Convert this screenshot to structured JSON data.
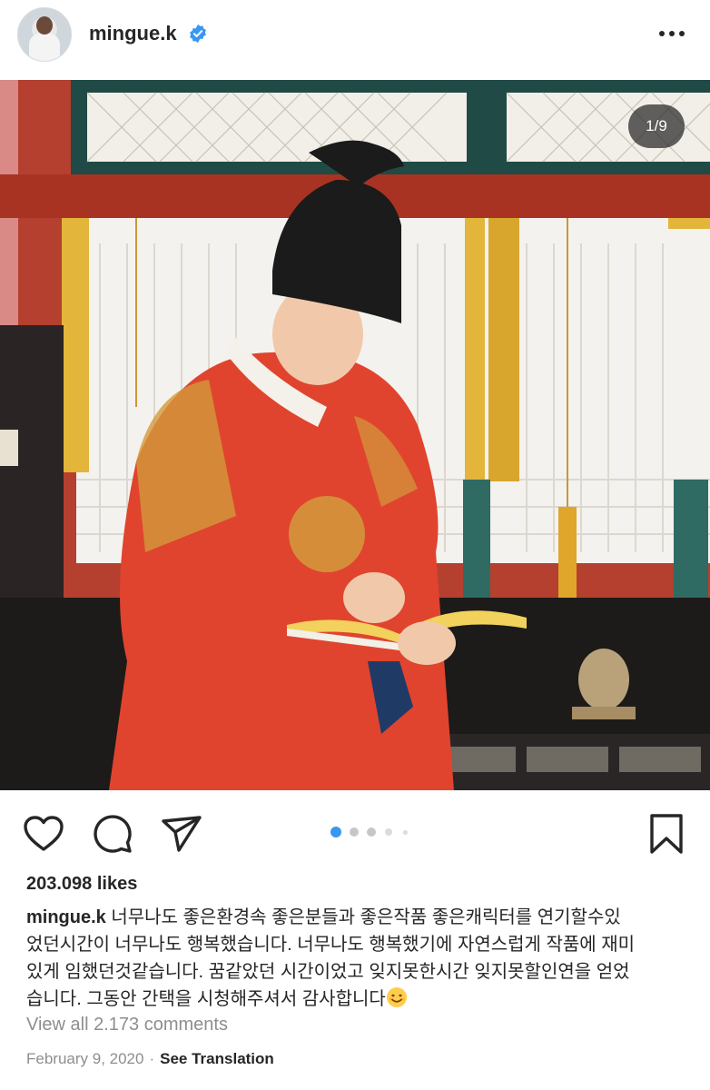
{
  "post": {
    "username": "mingue.k",
    "verified": true,
    "more_icon": "more-horizontal-icon"
  },
  "media": {
    "counter": "1/9",
    "current_index": 1,
    "total": 9,
    "description_icon": "photo"
  },
  "actions": {
    "like_icon": "heart-icon",
    "comment_icon": "comment-icon",
    "share_icon": "send-icon",
    "save_icon": "bookmark-icon",
    "carousel_dots": 5,
    "active_dot": 0,
    "accent_color": "#3897f0"
  },
  "likes": "203.098 likes",
  "caption": {
    "username": "mingue.k",
    "line1": "너무나도 좋은환경속 좋은분들과 좋은작품 좋은캐릭터를 연기할수있",
    "line2": "었던시간이 너무나도 행복했습니다. 너무나도 행복했기에 자연스럽게 작품에 재미",
    "line3": "있게 임했던것같습니다. 꿈같았던 시간이었고 잊지못한시간 잊지못할인연을 얻었",
    "line4": "습니다. 그동안 간택을 시청해주셔서 감사합니다",
    "emoji": "smiling-face-emoji"
  },
  "view_comments": "View all 2.173 comments",
  "date": "February 9, 2020",
  "separator": "·",
  "see_translation": "See Translation"
}
